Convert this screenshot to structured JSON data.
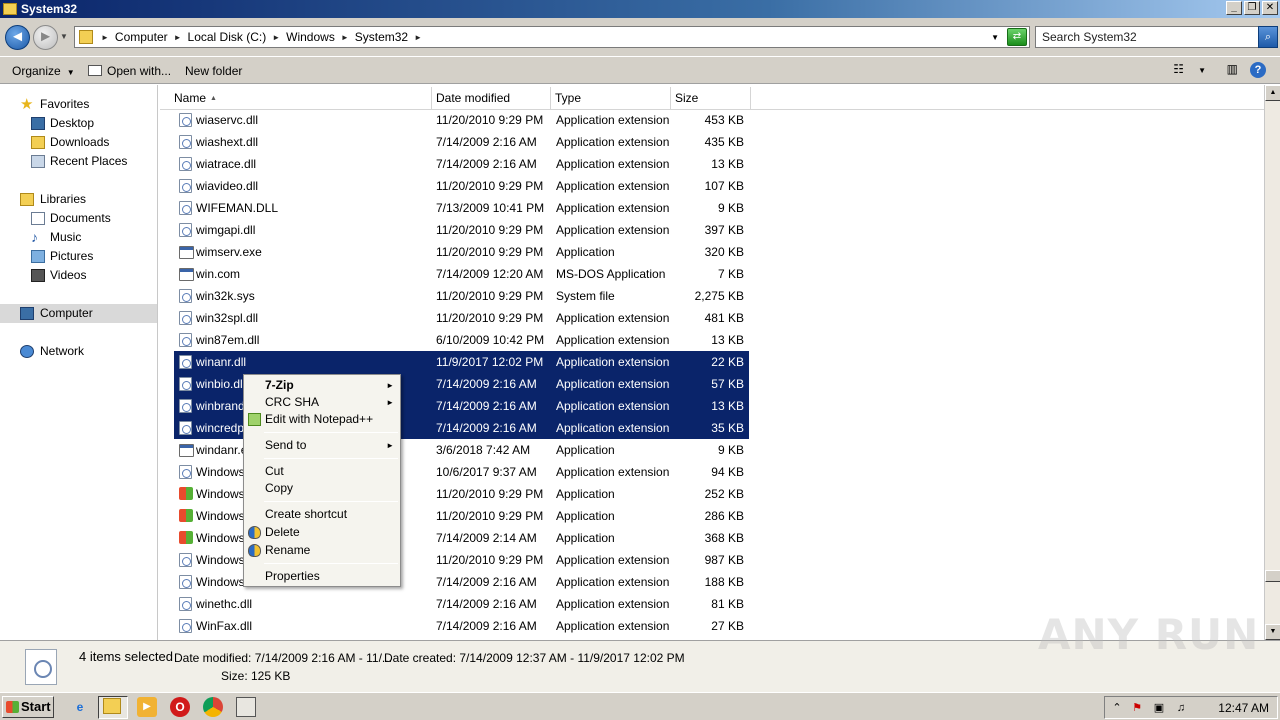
{
  "window": {
    "title": "System32",
    "min": "_",
    "restore": "❐",
    "close": "✕"
  },
  "address": {
    "back": "◄",
    "forward": "►",
    "crumbs": [
      "Computer",
      "Local Disk (C:)",
      "Windows",
      "System32"
    ],
    "search_placeholder": "Search System32",
    "search_icon": "⌕",
    "refresh_icon": "⇄"
  },
  "toolbar": {
    "organize": "Organize",
    "open_with": "Open with...",
    "new_folder": "New folder",
    "help": "?"
  },
  "nav": {
    "favorites": "Favorites",
    "desktop": "Desktop",
    "downloads": "Downloads",
    "recent": "Recent Places",
    "libraries": "Libraries",
    "documents": "Documents",
    "music": "Music",
    "pictures": "Pictures",
    "videos": "Videos",
    "computer": "Computer",
    "network": "Network"
  },
  "columns": {
    "name": "Name",
    "date": "Date modified",
    "type": "Type",
    "size": "Size"
  },
  "files": [
    {
      "name": "wiaservc.dll",
      "date": "11/20/2010 9:29 PM",
      "type": "Application extension",
      "size": "453 KB",
      "icon": "dll"
    },
    {
      "name": "wiashext.dll",
      "date": "7/14/2009 2:16 AM",
      "type": "Application extension",
      "size": "435 KB",
      "icon": "dll"
    },
    {
      "name": "wiatrace.dll",
      "date": "7/14/2009 2:16 AM",
      "type": "Application extension",
      "size": "13 KB",
      "icon": "dll"
    },
    {
      "name": "wiavideo.dll",
      "date": "11/20/2010 9:29 PM",
      "type": "Application extension",
      "size": "107 KB",
      "icon": "dll"
    },
    {
      "name": "WIFEMAN.DLL",
      "date": "7/13/2009 10:41 PM",
      "type": "Application extension",
      "size": "9 KB",
      "icon": "dll"
    },
    {
      "name": "wimgapi.dll",
      "date": "11/20/2010 9:29 PM",
      "type": "Application extension",
      "size": "397 KB",
      "icon": "dll"
    },
    {
      "name": "wimserv.exe",
      "date": "11/20/2010 9:29 PM",
      "type": "Application",
      "size": "320 KB",
      "icon": "app"
    },
    {
      "name": "win.com",
      "date": "7/14/2009 12:20 AM",
      "type": "MS-DOS Application",
      "size": "7 KB",
      "icon": "app"
    },
    {
      "name": "win32k.sys",
      "date": "11/20/2010 9:29 PM",
      "type": "System file",
      "size": "2,275 KB",
      "icon": "dll"
    },
    {
      "name": "win32spl.dll",
      "date": "11/20/2010 9:29 PM",
      "type": "Application extension",
      "size": "481 KB",
      "icon": "dll"
    },
    {
      "name": "win87em.dll",
      "date": "6/10/2009 10:42 PM",
      "type": "Application extension",
      "size": "13 KB",
      "icon": "dll"
    },
    {
      "name": "winanr.dll",
      "date": "11/9/2017 12:02 PM",
      "type": "Application extension",
      "size": "22 KB",
      "icon": "dll",
      "selected": true
    },
    {
      "name": "winbio.dll",
      "date": "7/14/2009 2:16 AM",
      "type": "Application extension",
      "size": "57 KB",
      "icon": "dll",
      "selected": true
    },
    {
      "name": "winbrand",
      "date": "7/14/2009 2:16 AM",
      "type": "Application extension",
      "size": "13 KB",
      "icon": "dll",
      "selected": true
    },
    {
      "name": "wincredpr",
      "date": "7/14/2009 2:16 AM",
      "type": "Application extension",
      "size": "35 KB",
      "icon": "dll",
      "selected": true
    },
    {
      "name": "windanr.e",
      "date": "3/6/2018 7:42 AM",
      "type": "Application",
      "size": "9 KB",
      "icon": "app"
    },
    {
      "name": "Windows/",
      "date": "10/6/2017 9:37 AM",
      "type": "Application extension",
      "size": "94 KB",
      "icon": "dll"
    },
    {
      "name": "Windows/",
      "date": "11/20/2010 9:29 PM",
      "type": "Application",
      "size": "252 KB",
      "icon": "win"
    },
    {
      "name": "Windows/",
      "date": "11/20/2010 9:29 PM",
      "type": "Application",
      "size": "286 KB",
      "icon": "win"
    },
    {
      "name": "Windows/",
      "date": "7/14/2009 2:14 AM",
      "type": "Application",
      "size": "368 KB",
      "icon": "win"
    },
    {
      "name": "Windows",
      "date": "11/20/2010 9:29 PM",
      "type": "Application extension",
      "size": "987 KB",
      "icon": "dll"
    },
    {
      "name": "Windows",
      "date": "7/14/2009 2:16 AM",
      "type": "Application extension",
      "size": "188 KB",
      "icon": "dll"
    },
    {
      "name": "winethc.dll",
      "date": "7/14/2009 2:16 AM",
      "type": "Application extension",
      "size": "81 KB",
      "icon": "dll"
    },
    {
      "name": "WinFax.dll",
      "date": "7/14/2009 2:16 AM",
      "type": "Application extension",
      "size": "27 KB",
      "icon": "dll"
    }
  ],
  "context_menu": {
    "zip": "7-Zip",
    "crc": "CRC SHA",
    "notepad": "Edit with Notepad++",
    "send_to": "Send to",
    "cut": "Cut",
    "copy": "Copy",
    "create_shortcut": "Create shortcut",
    "delete": "Delete",
    "rename": "Rename",
    "properties": "Properties",
    "arrow": "►"
  },
  "details": {
    "selected": "4 items selected",
    "modified": "Date modified: 7/14/2009 2:16 AM - 11/...",
    "created": "Date created: 7/14/2009 12:37 AM - 11/9/2017 12:02 PM",
    "size": "Size: 125 KB"
  },
  "taskbar": {
    "start": "Start",
    "clock": "12:47 AM"
  },
  "watermark": "ANY RUN",
  "colors": {
    "selection": "#0a246a",
    "title_gradient_start": "#0a246a",
    "chrome": "#d4d0c8"
  }
}
